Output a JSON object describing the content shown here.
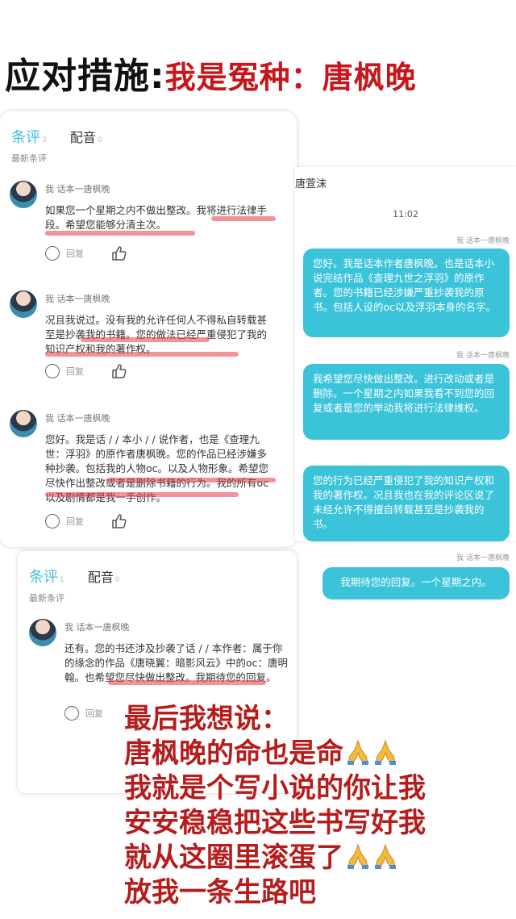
{
  "headline": {
    "prefix": "应对措施:",
    "suffix": "我是冤种：唐枫晚"
  },
  "comment_panel": {
    "tabs": [
      {
        "label": "条评",
        "count": "3"
      },
      {
        "label": "配音",
        "count": "0"
      }
    ],
    "section_label": "最新条评",
    "comments": [
      {
        "author": "我 话本一唐枫晚",
        "text": "如果您一个星期之内不做出整改。我将进行法律手段。希望您能够分清主次。",
        "reply_label": "回复"
      },
      {
        "author": "我 话本一唐枫晚",
        "text": "况且我说过。没有我的允许任何人不得私自转载甚至是抄袭我的书籍。您的做法已经严重侵犯了我的知识产权和我的著作权。",
        "reply_label": "回复"
      },
      {
        "author": "我 话本一唐枫晚",
        "text": "您好。我是话 / / 本小 / / 说作者，也是《查理九世：浮羽》的原作者唐枫晚。您的作品已经涉嫌多种抄袭。包括我的人物oc。以及人物形象。希望您尽快作出整改或者是删除书籍的行为。我的所有oc以及剧情都是我一手创作。",
        "reply_label": "回复"
      }
    ]
  },
  "chat": {
    "contact": "唐萱沫",
    "time": "11:02",
    "messages": [
      {
        "sender": "我 话本一唐枫晚",
        "text": "您好。我是话本作者唐枫晚。也是话本小说完结作品《查理九世之浮羽》的原作者。您的书籍已经涉嫌严重抄袭我的原书。包括人设的oc以及浮羽本身的名字。"
      },
      {
        "sender": "我 话本一唐枫晚",
        "text": "我希望您尽快做出整改。进行改动或者是删除。一个星期之内如果我看不到您的回复或者是您的举动我将进行法律维权。"
      },
      {
        "sender": "",
        "text": "您的行为已经严重侵犯了我的知识产权和我的著作权。况且我也在我的评论区说了未经允许不得擅自转载甚至是抄袭我的书。"
      },
      {
        "sender": "我 话本一唐枫晚",
        "text": "我期待您的回复。一个星期之内。"
      }
    ]
  },
  "comment_panel_2": {
    "tabs": [
      {
        "label": "条评",
        "count": "1"
      },
      {
        "label": "配音",
        "count": "0"
      }
    ],
    "section_label": "最新条评",
    "comments": [
      {
        "author": "我 话本一唐枫晚",
        "text": "还有。您的书还涉及抄袭了话 / / 本作者：属于你的缘念的作品《唐晓翼：暗影风云》中的oc：唐明翰。也希望您尽快做出整改。我期待您的回复。",
        "reply_label": "回复"
      }
    ]
  },
  "statement": {
    "lines": [
      "最后我想说：",
      "唐枫晚的命也是命",
      "我就是个写小说的你让我",
      "安安稳稳把这些书写好我",
      "就从这圈里滚蛋了",
      "放我一条生路吧"
    ],
    "icon": "folded-hands-icon"
  },
  "colors": {
    "accent": "#3bc3da",
    "headline_red": "#c8161d",
    "statement_red": "#b71c1c"
  }
}
